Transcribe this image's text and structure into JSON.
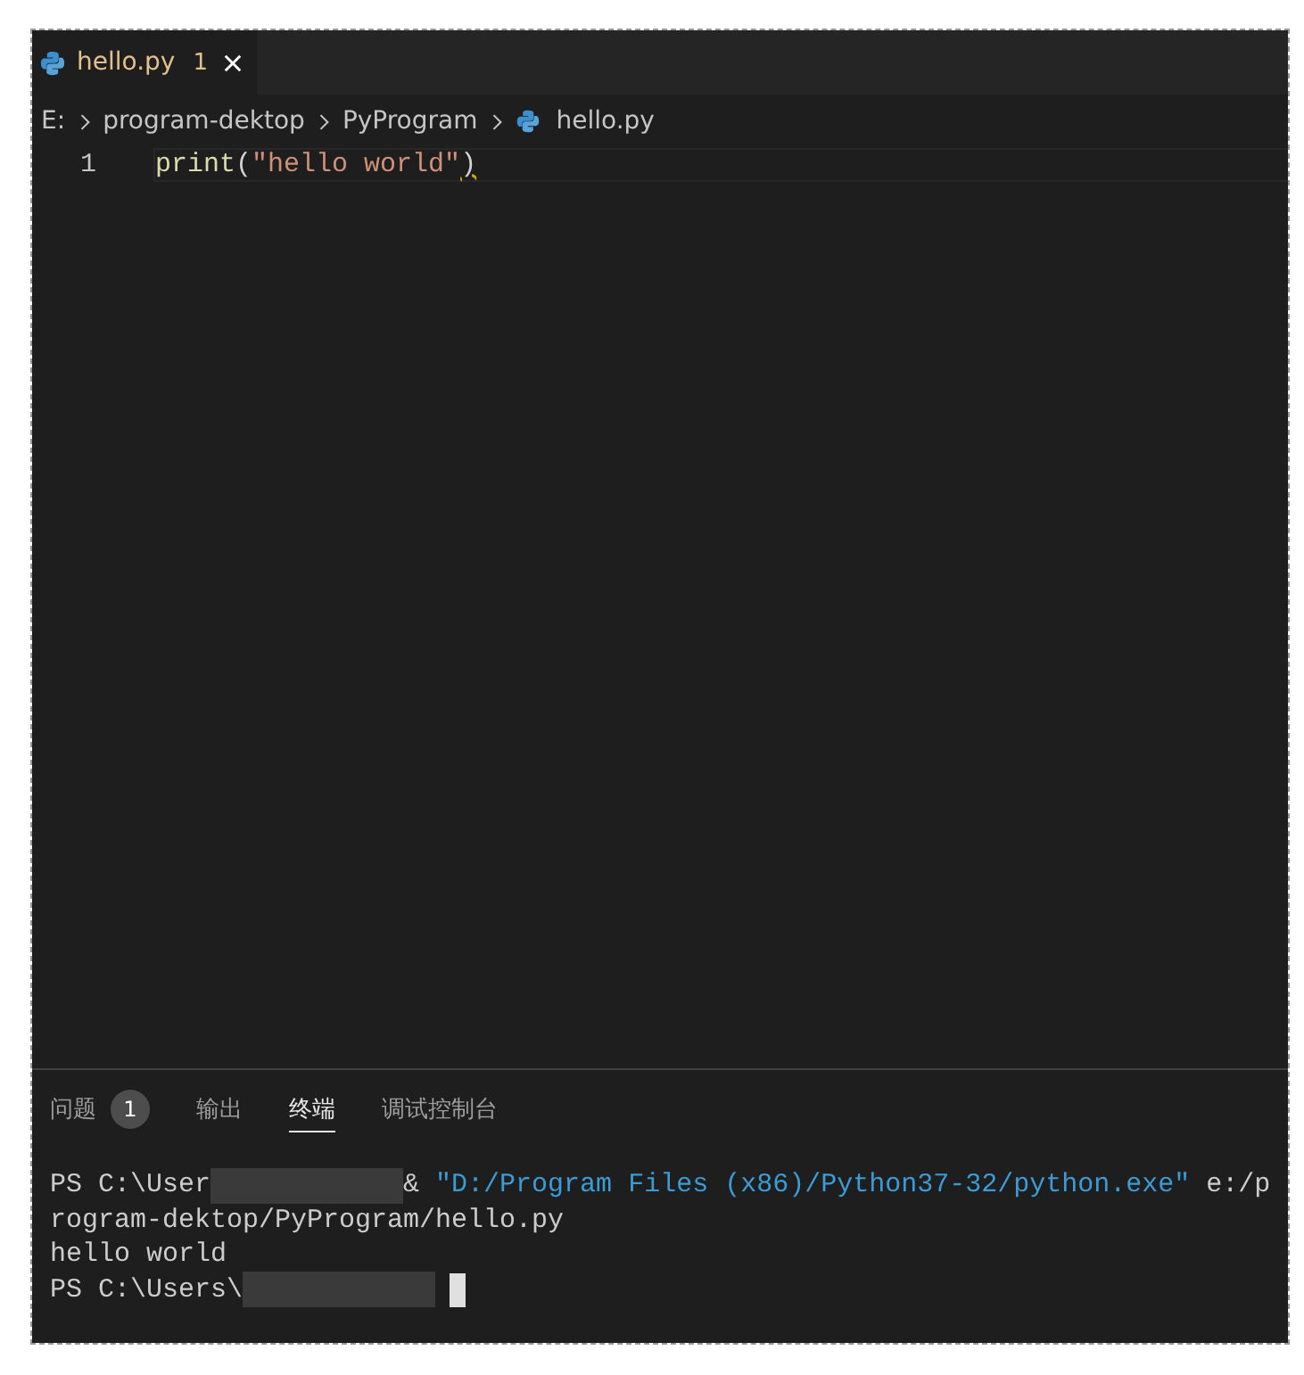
{
  "editor_tabs": [
    {
      "label": "hello.py",
      "problems": "1",
      "selected": true
    }
  ],
  "breadcrumb": [
    "E:",
    "program-dektop",
    "PyProgram",
    "hello.py"
  ],
  "code_lines": [
    {
      "number": "1",
      "segments": [
        {
          "kind": "func",
          "text": "print"
        },
        {
          "kind": "punct",
          "text": "("
        },
        {
          "kind": "string",
          "text": "\"hello world\""
        },
        {
          "kind": "warn",
          "text": ")"
        }
      ]
    }
  ],
  "panel_tabs": [
    {
      "label": "问题",
      "badge": "1",
      "selected": false
    },
    {
      "label": "输出",
      "selected": false
    },
    {
      "label": "终端",
      "selected": true
    },
    {
      "label": "调试控制台",
      "selected": false
    }
  ],
  "terminal_lines": [
    {
      "segments": [
        {
          "kind": "plain",
          "text": "PS C:\\User"
        },
        {
          "kind": "redacted"
        },
        {
          "kind": "plain",
          "text": "& "
        },
        {
          "kind": "string",
          "text": "\"D:/Program Files (x86)/Python37-32/python.exe\""
        },
        {
          "kind": "plain",
          "text": " e:/p"
        }
      ]
    },
    {
      "segments": [
        {
          "kind": "plain",
          "text": "rogram-dektop/PyProgram/hello.py"
        }
      ]
    },
    {
      "segments": [
        {
          "kind": "plain",
          "text": "hello world"
        }
      ]
    },
    {
      "segments": [
        {
          "kind": "plain",
          "text": "PS C:\\Users\\"
        },
        {
          "kind": "redacted"
        },
        {
          "kind": "cursor"
        }
      ]
    }
  ]
}
